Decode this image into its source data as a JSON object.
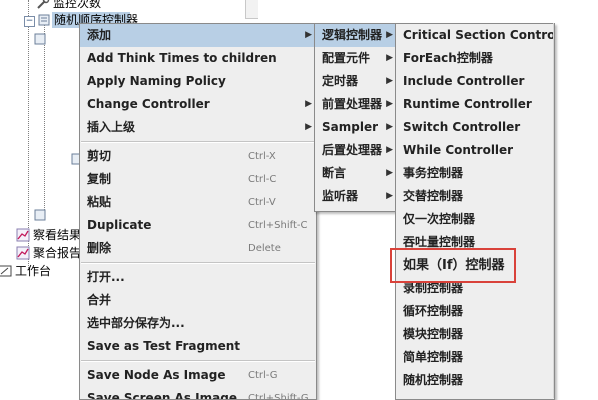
{
  "tree": {
    "nodes": [
      {
        "label": "监控次数"
      },
      {
        "label": "随机顺序控制器"
      },
      {
        "label": "察看结果树"
      },
      {
        "label": "聚合报告"
      },
      {
        "label": "工作台"
      }
    ]
  },
  "context_menu": {
    "items": [
      {
        "label": "添加",
        "has_submenu": true
      },
      {
        "label": "Add Think Times to children"
      },
      {
        "label": "Apply Naming Policy"
      },
      {
        "label": "Change Controller",
        "has_submenu": true
      },
      {
        "label": "插入上级",
        "has_submenu": true
      },
      {
        "label": "剪切",
        "shortcut": "Ctrl-X"
      },
      {
        "label": "复制",
        "shortcut": "Ctrl-C"
      },
      {
        "label": "粘贴",
        "shortcut": "Ctrl-V"
      },
      {
        "label": "Duplicate",
        "shortcut": "Ctrl+Shift-C"
      },
      {
        "label": "删除",
        "shortcut": "Delete"
      },
      {
        "label": "打开..."
      },
      {
        "label": "合并"
      },
      {
        "label": "选中部分保存为..."
      },
      {
        "label": "Save as Test Fragment"
      },
      {
        "label": "Save Node As Image",
        "shortcut": "Ctrl-G"
      },
      {
        "label": "Save Screen As Image",
        "shortcut": "Ctrl+Shift-G"
      }
    ]
  },
  "add_submenu": {
    "items": [
      {
        "label": "逻辑控制器",
        "has_submenu": true
      },
      {
        "label": "配置元件",
        "has_submenu": true
      },
      {
        "label": "定时器",
        "has_submenu": true
      },
      {
        "label": "前置处理器",
        "has_submenu": true
      },
      {
        "label": "Sampler",
        "has_submenu": true
      },
      {
        "label": "后置处理器",
        "has_submenu": true
      },
      {
        "label": "断言",
        "has_submenu": true
      },
      {
        "label": "监听器",
        "has_submenu": true
      }
    ]
  },
  "logic_controller_submenu": {
    "items": [
      {
        "label": "Critical Section Controller"
      },
      {
        "label": "ForEach控制器"
      },
      {
        "label": "Include Controller"
      },
      {
        "label": "Runtime Controller"
      },
      {
        "label": "Switch Controller"
      },
      {
        "label": "While Controller"
      },
      {
        "label": "事务控制器"
      },
      {
        "label": "交替控制器"
      },
      {
        "label": "仅一次控制器"
      },
      {
        "label": "吞吐量控制器"
      },
      {
        "label": "如果（If）控制器"
      },
      {
        "label": "录制控制器"
      },
      {
        "label": "循环控制器"
      },
      {
        "label": "模块控制器"
      },
      {
        "label": "简单控制器"
      },
      {
        "label": "随机控制器"
      }
    ]
  },
  "colors": {
    "menu_bg": "#eeeeee",
    "highlight": "#b8cfe5",
    "annotation_box": "#d9423a"
  },
  "icons": {
    "submenu_arrow": "▶",
    "toggle_expand": "−"
  }
}
